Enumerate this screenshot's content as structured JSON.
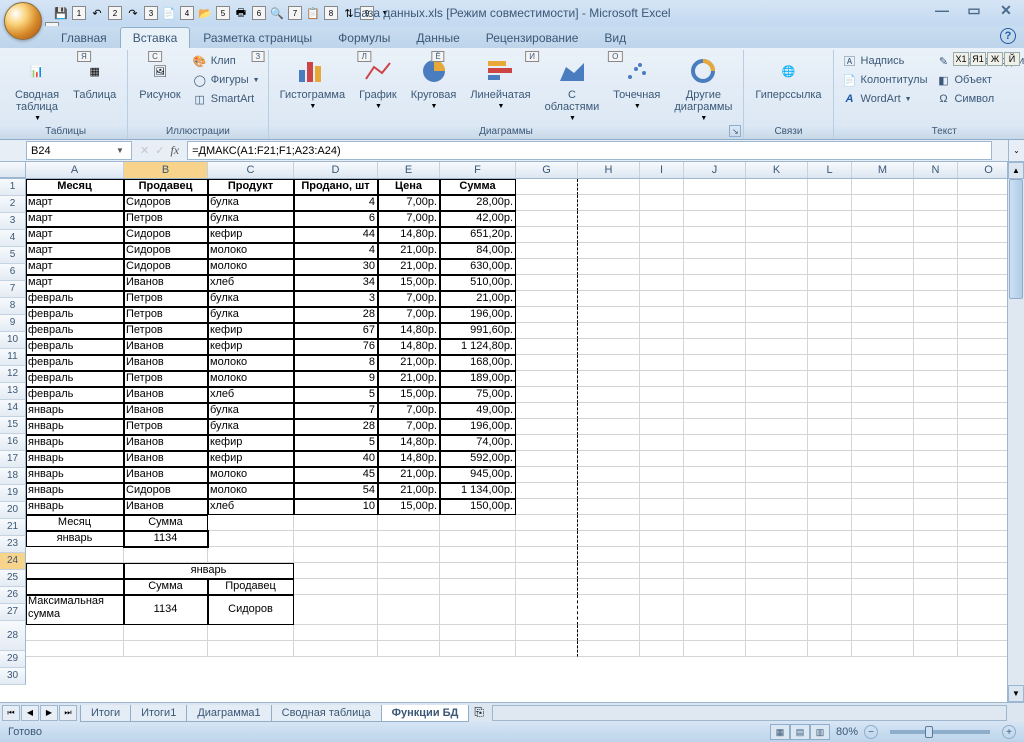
{
  "title": "База данных.xls  [Режим совместимости] - Microsoft Excel",
  "qat_nums": [
    "1",
    "2",
    "3",
    "4",
    "5",
    "6",
    "7",
    "8",
    "9"
  ],
  "tabs": [
    {
      "label": "Главная",
      "key": "Я"
    },
    {
      "label": "Вставка",
      "key": "С",
      "active": true
    },
    {
      "label": "Разметка страницы",
      "key": "З"
    },
    {
      "label": "Формулы",
      "key": "Л"
    },
    {
      "label": "Данные",
      "key": "Ё"
    },
    {
      "label": "Рецензирование",
      "key": "И"
    },
    {
      "label": "Вид",
      "key": "О"
    }
  ],
  "doc_keys": [
    "Х1",
    "Я1",
    "Ж",
    "Й"
  ],
  "qat_key": "Я2",
  "ribbon": {
    "tables": {
      "label": "Таблицы",
      "pivot": "Сводная\nтаблица",
      "table": "Таблица"
    },
    "illus": {
      "label": "Иллюстрации",
      "picture": "Рисунок",
      "clip": "Клип",
      "shapes": "Фигуры",
      "smartart": "SmartArt"
    },
    "charts": {
      "label": "Диаграммы",
      "col": "Гистограмма",
      "line": "График",
      "pie": "Круговая",
      "bar": "Линейчатая",
      "area": "С\nобластями",
      "scatter": "Точечная",
      "other": "Другие\nдиаграммы"
    },
    "links": {
      "label": "Связи",
      "hyperlink": "Гиперссылка"
    },
    "text": {
      "label": "Текст",
      "textbox": "Надпись",
      "header": "Колонтитулы",
      "wordart": "WordArt",
      "sig": "Строка подписи",
      "obj": "Объект",
      "sym": "Символ"
    }
  },
  "namebox": "B24",
  "formula": "=ДМАКС(A1:F21;F1;A23:A24)",
  "columns": [
    "A",
    "B",
    "C",
    "D",
    "E",
    "F",
    "G",
    "H",
    "I",
    "J",
    "K",
    "L",
    "M",
    "N",
    "O"
  ],
  "colwidths": [
    "cw-A",
    "cw-B",
    "cw-C",
    "cw-D",
    "cw-E",
    "cw-F",
    "cw-G",
    "cw-H",
    "cw-I",
    "cw-J",
    "cw-K",
    "cw-L",
    "cw-M",
    "cw-N",
    "cw-O"
  ],
  "headers": [
    "Месяц",
    "Продавец",
    "Продукт",
    "Продано, шт",
    "Цена",
    "Сумма"
  ],
  "rows": [
    [
      "март",
      "Сидоров",
      "булка",
      "4",
      "7,00р.",
      "28,00р."
    ],
    [
      "март",
      "Петров",
      "булка",
      "6",
      "7,00р.",
      "42,00р."
    ],
    [
      "март",
      "Сидоров",
      "кефир",
      "44",
      "14,80р.",
      "651,20р."
    ],
    [
      "март",
      "Сидоров",
      "молоко",
      "4",
      "21,00р.",
      "84,00р."
    ],
    [
      "март",
      "Сидоров",
      "молоко",
      "30",
      "21,00р.",
      "630,00р."
    ],
    [
      "март",
      "Иванов",
      "хлеб",
      "34",
      "15,00р.",
      "510,00р."
    ],
    [
      "февраль",
      "Петров",
      "булка",
      "3",
      "7,00р.",
      "21,00р."
    ],
    [
      "февраль",
      "Петров",
      "булка",
      "28",
      "7,00р.",
      "196,00р."
    ],
    [
      "февраль",
      "Петров",
      "кефир",
      "67",
      "14,80р.",
      "991,60р."
    ],
    [
      "февраль",
      "Иванов",
      "кефир",
      "76",
      "14,80р.",
      "1 124,80р."
    ],
    [
      "февраль",
      "Иванов",
      "молоко",
      "8",
      "21,00р.",
      "168,00р."
    ],
    [
      "февраль",
      "Петров",
      "молоко",
      "9",
      "21,00р.",
      "189,00р."
    ],
    [
      "февраль",
      "Иванов",
      "хлеб",
      "5",
      "15,00р.",
      "75,00р."
    ],
    [
      "январь",
      "Иванов",
      "булка",
      "7",
      "7,00р.",
      "49,00р."
    ],
    [
      "январь",
      "Петров",
      "булка",
      "28",
      "7,00р.",
      "196,00р."
    ],
    [
      "январь",
      "Иванов",
      "кефир",
      "5",
      "14,80р.",
      "74,00р."
    ],
    [
      "январь",
      "Иванов",
      "кефир",
      "40",
      "14,80р.",
      "592,00р."
    ],
    [
      "январь",
      "Иванов",
      "молоко",
      "45",
      "21,00р.",
      "945,00р."
    ],
    [
      "январь",
      "Сидоров",
      "молоко",
      "54",
      "21,00р.",
      "1 134,00р."
    ],
    [
      "январь",
      "Иванов",
      "хлеб",
      "10",
      "15,00р.",
      "150,00р."
    ]
  ],
  "criteria": {
    "h1": "Месяц",
    "h2": "Сумма",
    "v1": "январь",
    "v2": "1134"
  },
  "result": {
    "title": "январь",
    "h1": "Сумма",
    "h2": "Продавец",
    "lbl": "Максимальная сумма",
    "v1": "1134",
    "v2": "Сидоров"
  },
  "sheets": [
    "Итоги",
    "Итоги1",
    "Диаграмма1",
    "Сводная таблица",
    "Функции БД"
  ],
  "active_sheet": 4,
  "status": "Готово",
  "zoom": "80%"
}
